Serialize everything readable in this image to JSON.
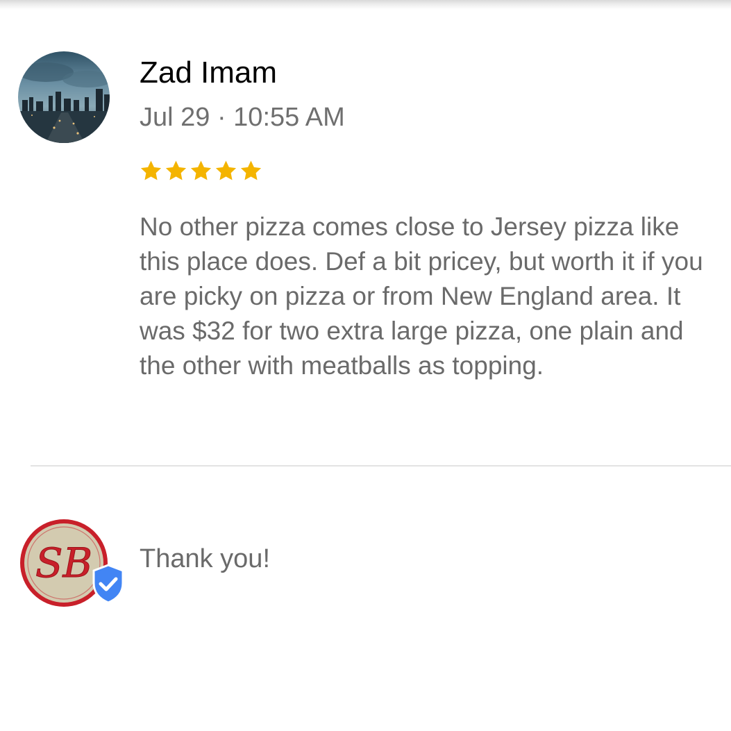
{
  "review": {
    "reviewer_name": "Zad Imam",
    "date": "Jul 29 · 10:55 AM",
    "rating": 5,
    "rating_max": 5,
    "star_color": "#f4b400",
    "text": "No other pizza comes close to Jersey pizza like this place does. Def a bit pricey, but worth it if you are picky on pizza or from New England area. It was $32 for two extra large pizza, one plain and the other with meatballs as topping.",
    "avatar_icon": "city-skyline-photo"
  },
  "owner_response": {
    "logo_text": "SB",
    "logo_colors": {
      "ring": "#c8202a",
      "fill": "#d3cbb0"
    },
    "verified_icon": "verified-shield-check-icon",
    "verified_color": "#4285f4",
    "text": "Thank you!"
  }
}
